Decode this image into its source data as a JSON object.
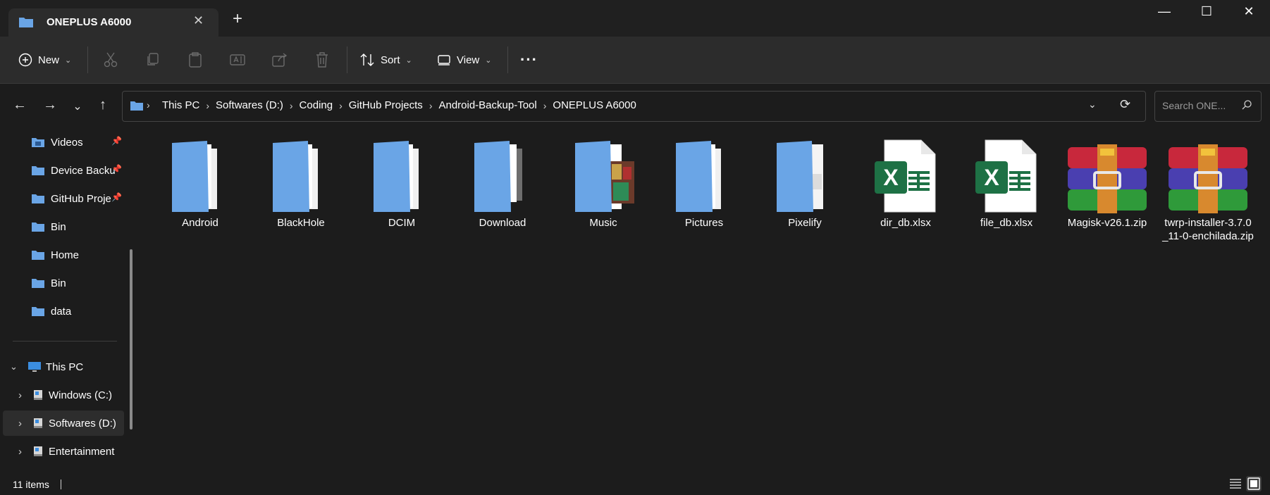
{
  "window": {
    "tab_title": "ONEPLUS A6000",
    "new_tab_label": "+",
    "minimize": "—",
    "maximize": "☐",
    "close": "✕"
  },
  "toolbar": {
    "new_label": "New",
    "sort_label": "Sort",
    "view_label": "View",
    "more_label": "···"
  },
  "address": {
    "crumbs": [
      "This PC",
      "Softwares (D:)",
      "Coding",
      "GitHub Projects",
      "Android-Backup-Tool",
      "ONEPLUS A6000"
    ]
  },
  "search": {
    "placeholder": "Search ONE..."
  },
  "sidebar": {
    "pinned": [
      {
        "label": "Videos",
        "icon": "videos-folder-icon",
        "pinned": true
      },
      {
        "label": "Device Backu",
        "icon": "folder-icon",
        "pinned": true
      },
      {
        "label": "GitHub Proje",
        "icon": "folder-icon",
        "pinned": true
      },
      {
        "label": "Bin",
        "icon": "folder-icon",
        "pinned": false
      },
      {
        "label": "Home",
        "icon": "folder-icon",
        "pinned": false
      },
      {
        "label": "Bin",
        "icon": "folder-icon",
        "pinned": false
      },
      {
        "label": "data",
        "icon": "folder-icon",
        "pinned": false
      }
    ],
    "this_pc": "This PC",
    "drives": [
      {
        "label": "Windows (C:)",
        "selected": false
      },
      {
        "label": "Softwares (D:)",
        "selected": true
      },
      {
        "label": "Entertainment",
        "selected": false
      }
    ]
  },
  "files": [
    {
      "name": "Android",
      "type": "folder"
    },
    {
      "name": "BlackHole",
      "type": "folder"
    },
    {
      "name": "DCIM",
      "type": "folder"
    },
    {
      "name": "Download",
      "type": "folder"
    },
    {
      "name": "Music",
      "type": "folder"
    },
    {
      "name": "Pictures",
      "type": "folder"
    },
    {
      "name": "Pixelify",
      "type": "folder"
    },
    {
      "name": "dir_db.xlsx",
      "type": "excel"
    },
    {
      "name": "file_db.xlsx",
      "type": "excel"
    },
    {
      "name": "Magisk-v26.1.zip",
      "type": "zip"
    },
    {
      "name": "twrp-installer-3.7.0_11-0-enchilada.zip",
      "type": "zip"
    }
  ],
  "status": {
    "item_count": "11 items"
  },
  "colors": {
    "folder": "#6aa5e6",
    "excel": "#1e7145",
    "background": "#1c1c1c"
  }
}
